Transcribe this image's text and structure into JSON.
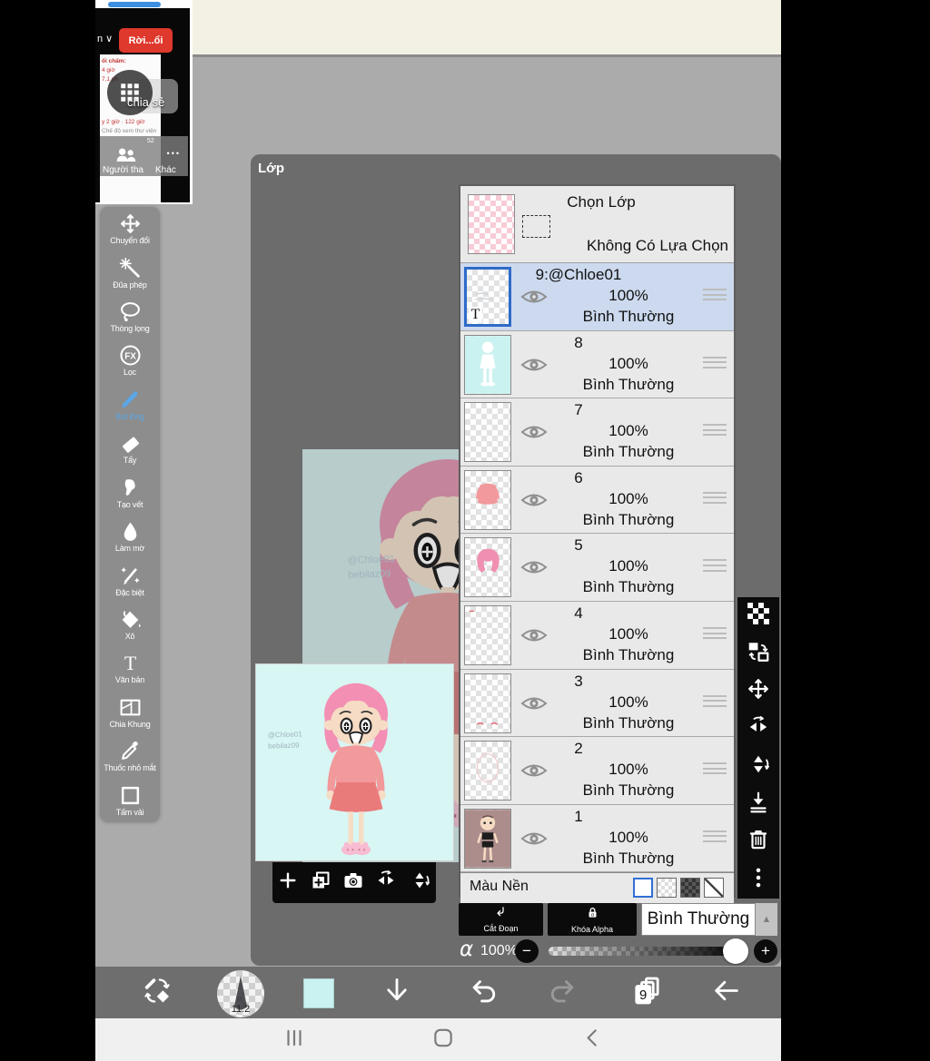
{
  "share_overlay": {
    "leave_button": "Rời...ổi",
    "collapsed_label": "n ∨",
    "share_label": "chia sẻ",
    "member_count": "52",
    "more_dots": "•••",
    "people_label": "Người tha",
    "other_label": "Khác",
    "note_lines": [
      "ổi chấm:",
      "4 giờ",
      "7,1 ph",
      "y 2 giờ · 122 giờ",
      "Chế độ xem thư viện"
    ],
    "handle_color": "#3d8fe0",
    "leave_color": "#df382c"
  },
  "tool_sidebar": {
    "tools": [
      {
        "label": "Chuyển đổi",
        "icon": "move-icon",
        "selected": false
      },
      {
        "label": "Đũa phép",
        "icon": "wand-icon",
        "selected": false
      },
      {
        "label": "Thòng lọng",
        "icon": "lasso-icon",
        "selected": false
      },
      {
        "label": "Lọc",
        "icon": "fx-icon",
        "selected": false
      },
      {
        "label": "Bút lông",
        "icon": "brush-icon",
        "selected": true
      },
      {
        "label": "Tẩy",
        "icon": "eraser-icon",
        "selected": false
      },
      {
        "label": "Tạo vết",
        "icon": "smudge-icon",
        "selected": false
      },
      {
        "label": "Làm mờ",
        "icon": "blur-icon",
        "selected": false
      },
      {
        "label": "Đặc biệt",
        "icon": "special-pen-icon",
        "selected": false
      },
      {
        "label": "Xô",
        "icon": "bucket-icon",
        "selected": false
      },
      {
        "label": "Văn bản",
        "icon": "text-icon",
        "selected": false
      },
      {
        "label": "Chia Khung",
        "icon": "frame-icon",
        "selected": false
      },
      {
        "label": "Thuốc nhỏ mắt",
        "icon": "eyedropper-icon",
        "selected": false
      },
      {
        "label": "Tấm vải",
        "icon": "canvas-icon",
        "selected": false
      }
    ]
  },
  "layers_panel": {
    "title": "Lớp",
    "header": {
      "title": "Chọn Lớp",
      "subtitle": "Không Có Lựa Chọn"
    },
    "layers": [
      {
        "name": "9:@Chloe01",
        "opacity": "100%",
        "blend": "Bình Thường",
        "selected": true,
        "thumb": "text-layer",
        "badge": "T"
      },
      {
        "name": "8",
        "opacity": "100%",
        "blend": "Bình Thường",
        "selected": false,
        "thumb": "cyan-figure"
      },
      {
        "name": "7",
        "opacity": "100%",
        "blend": "Bình Thường",
        "selected": false,
        "thumb": "empty"
      },
      {
        "name": "6",
        "opacity": "100%",
        "blend": "Bình Thường",
        "selected": false,
        "thumb": "sweater"
      },
      {
        "name": "5",
        "opacity": "100%",
        "blend": "Bình Thường",
        "selected": false,
        "thumb": "hair"
      },
      {
        "name": "4",
        "opacity": "100%",
        "blend": "Bình Thường",
        "selected": false,
        "thumb": "speck-top"
      },
      {
        "name": "3",
        "opacity": "100%",
        "blend": "Bình Thường",
        "selected": false,
        "thumb": "marks-bottom"
      },
      {
        "name": "2",
        "opacity": "100%",
        "blend": "Bình Thường",
        "selected": false,
        "thumb": "faint-sketch"
      },
      {
        "name": "1",
        "opacity": "100%",
        "blend": "Bình Thường",
        "selected": false,
        "thumb": "base-body"
      }
    ],
    "background_label": "Màu Nền",
    "clip_button": "Cắt Đoạn",
    "alpha_lock_button": "Khóa Alpha",
    "blend_mode": "Bình Thường",
    "alpha_symbol": "α",
    "alpha_value": "100%"
  },
  "canvas": {
    "watermark_line1": "@Chloe01",
    "watermark_line2": "bebilaz09"
  },
  "bottom_toolbar": {
    "brush_size": "11.2",
    "pages_count": "9",
    "current_color": "#c9f2f0"
  },
  "colors": {
    "accent_blue": "#2e6bc8",
    "selected_row": "#ccd9ee",
    "canvas_cyan": "#d8f6f4",
    "leave_red": "#df382c"
  }
}
